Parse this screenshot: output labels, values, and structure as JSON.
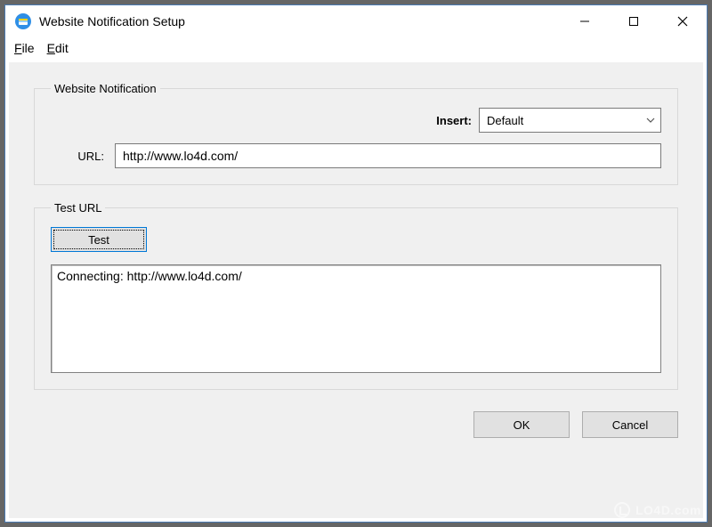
{
  "window": {
    "title": "Website Notification Setup"
  },
  "menubar": {
    "file": "File",
    "edit": "Edit"
  },
  "groupNotification": {
    "legend": "Website Notification",
    "insertLabel": "Insert:",
    "insertValue": "Default",
    "urlLabel": "URL:",
    "urlValue": "http://www.lo4d.com/"
  },
  "groupTest": {
    "legend": "Test URL",
    "testButton": "Test",
    "log": "Connecting: http://www.lo4d.com/"
  },
  "footer": {
    "ok": "OK",
    "cancel": "Cancel"
  },
  "watermark": "LO4D.com"
}
